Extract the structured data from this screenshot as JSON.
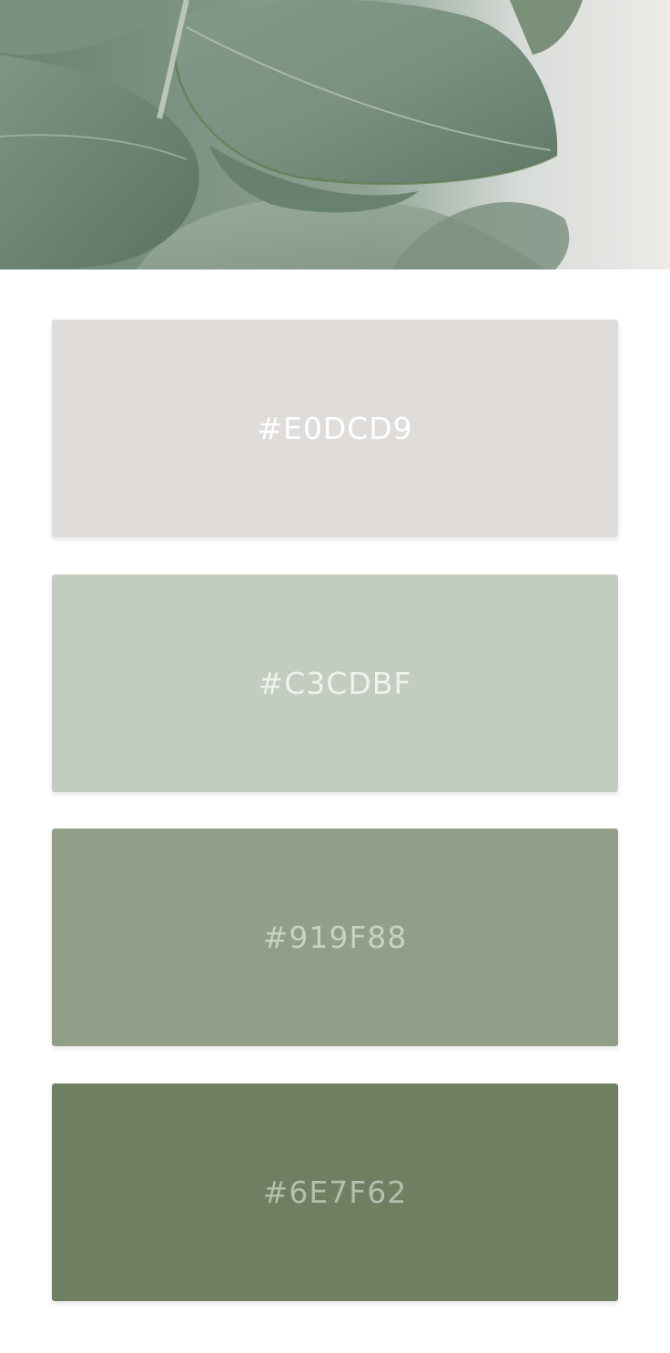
{
  "palette": {
    "swatches": [
      {
        "label": "#E0DCD9",
        "color": "#E0DCD9",
        "text_color": "#ffffff"
      },
      {
        "label": "#C3CDBF",
        "color": "#C3CDBF",
        "text_color": "#eef1ec"
      },
      {
        "label": "#919F88",
        "color": "#919F88",
        "text_color": "#c9d1c3"
      },
      {
        "label": "#6E7F62",
        "color": "#6E7F62",
        "text_color": "#b4bfad"
      }
    ]
  },
  "hero": {
    "subject": "eucalyptus-leaves-photo",
    "colors": {
      "leaf_dark": "#5f7763",
      "leaf_mid": "#7d9482",
      "leaf_light": "#9aae9f",
      "vein": "#c4d0c6",
      "background": "#ecebe8"
    }
  }
}
